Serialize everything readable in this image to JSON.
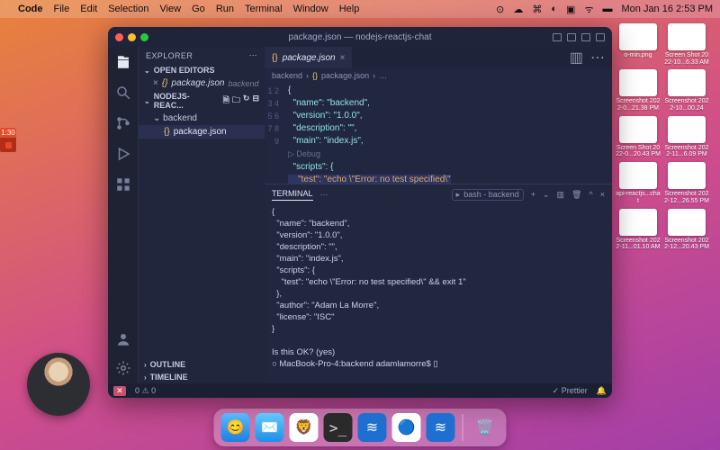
{
  "menubar": {
    "app": "Code",
    "items": [
      "File",
      "Edit",
      "Selection",
      "View",
      "Go",
      "Run",
      "Terminal",
      "Window",
      "Help"
    ],
    "clock": "Mon Jan 16  2:53 PM"
  },
  "desktop_files": [
    {
      "label": "o-min.png"
    },
    {
      "label": "Screen Shot 2022-10...6.33 AM"
    },
    {
      "label": "Screenshot 2022-0...21.38 PM"
    },
    {
      "label": "Screenshot 2022-10...00.24"
    },
    {
      "label": "Screen Shot 2022-0...20.43 PM"
    },
    {
      "label": "Screenshot 2022-11...6.09 PM"
    },
    {
      "label": "api-reactjs...chat"
    },
    {
      "label": "Screenshot 2022-12...26.55 PM"
    },
    {
      "label": "Screenshot 2022-11...01.10 AM"
    },
    {
      "label": "Screenshot 2022-12...20.43 PM"
    }
  ],
  "rec_time": "1:30",
  "vscode": {
    "title": "package.json — nodejs-reactjs-chat",
    "explorer": {
      "label": "EXPLORER",
      "open_editors": {
        "label": "OPEN EDITORS"
      },
      "open_file": {
        "name": "package.json",
        "dir": "backend"
      },
      "project": {
        "label": "NODEJS-REAC..."
      },
      "folder": "backend",
      "file": "package.json",
      "outline": "OUTLINE",
      "timeline": "TIMELINE"
    },
    "tab": {
      "name": "package.json"
    },
    "breadcrumb": {
      "seg1": "backend",
      "seg2": "package.json"
    },
    "code": {
      "l1": "{",
      "l2": "  \"name\": \"backend\",",
      "l3": "  \"version\": \"1.0.0\",",
      "l4": "  \"description\": \"\",",
      "l5": "  \"main\": \"index.js\",",
      "debug": "▷ Debug",
      "l6": "  \"scripts\": {",
      "l7": "    \"test\": \"echo \\\"Error: no test specified\\\"",
      "l8": "  },",
      "l9": "  \"author\": \"Adam La Morre\","
    },
    "terminal": {
      "label": "TERMINAL",
      "shell": "bash - backend",
      "out1": "{",
      "out2": "  \"name\": \"backend\",",
      "out3": "  \"version\": \"1.0.0\",",
      "out4": "  \"description\": \"\",",
      "out5": "  \"main\": \"index.js\",",
      "out6": "  \"scripts\": {",
      "out7": "    \"test\": \"echo \\\"Error: no test specified\\\" && exit 1\"",
      "out8": "  },",
      "out9": "  \"author\": \"Adam La Morre\",",
      "out10": "  \"license\": \"ISC\"",
      "out11": "}",
      "out12": "",
      "prompt1": "Is this OK? (yes)",
      "prompt2": "○ MacBook-Pro-4:backend adamlamorre$ ▯"
    },
    "status": {
      "errors": "✕",
      "warn": "0 ⚠ 0",
      "prettier": "✓ Prettier"
    }
  }
}
